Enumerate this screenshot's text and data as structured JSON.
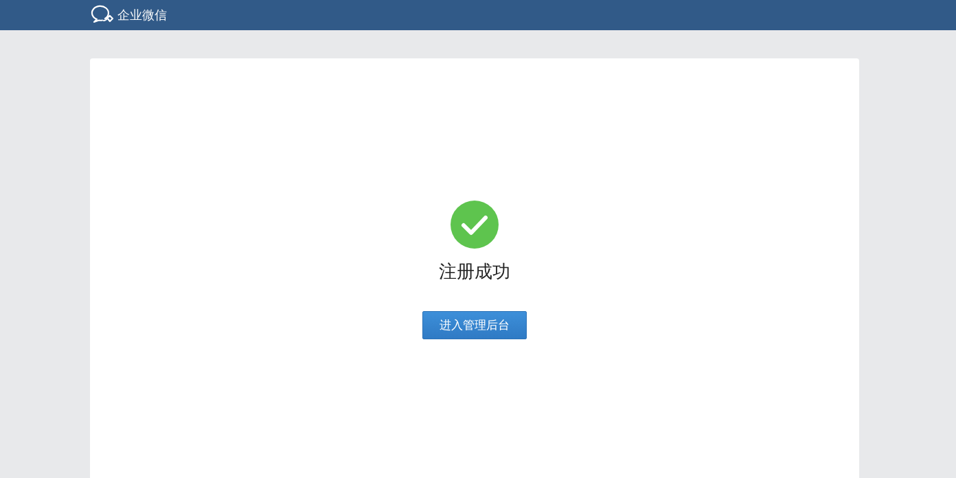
{
  "header": {
    "brand": "企业微信"
  },
  "result": {
    "success": true,
    "title": "注册成功",
    "button": "进入管理后台"
  }
}
